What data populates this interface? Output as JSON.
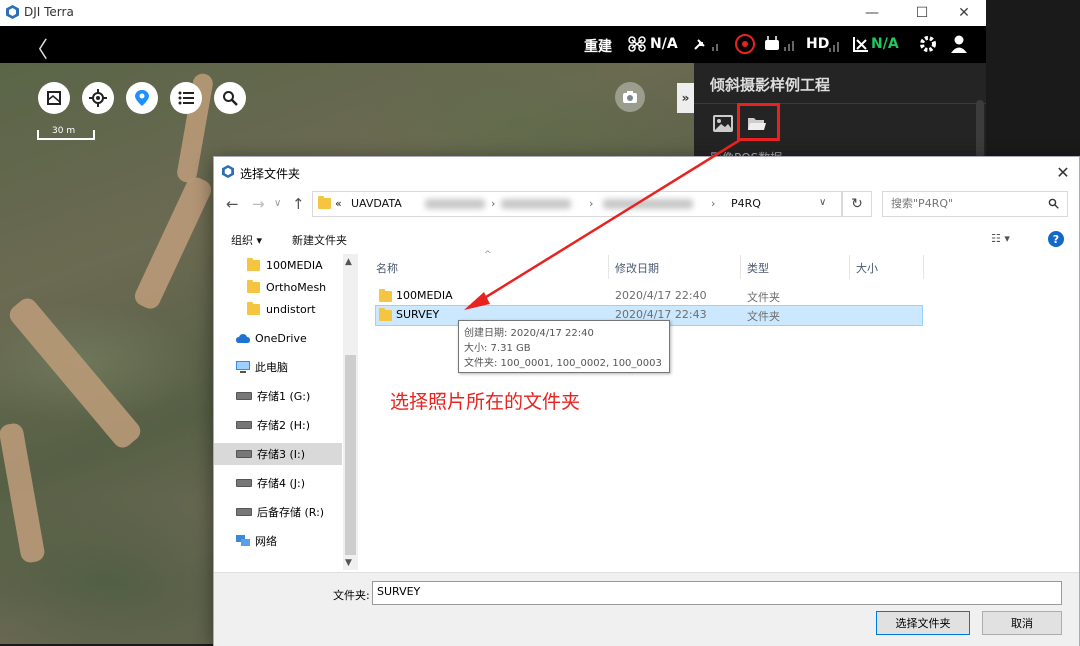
{
  "app": {
    "title": "DJI Terra",
    "min_label": "—",
    "max_label": "☐",
    "close_label": "✕"
  },
  "topbar": {
    "back_glyph": "〈",
    "rebuild": "重建",
    "drone_status": "N/A",
    "hd_label": "HD",
    "rc_status": "N/A",
    "status_green": "#22c55e"
  },
  "map": {
    "scale_label": "30 m"
  },
  "panel": {
    "project_title": "倾斜摄影样例工程",
    "collapse_label": "»",
    "partial_row": "影像POS数据"
  },
  "dialog": {
    "title": "选择文件夹",
    "address": {
      "prefix": "«",
      "part1": "UAVDATA",
      "sep": "›",
      "part_last": "P4RQ"
    },
    "search_placeholder": "搜索\"P4RQ\"",
    "organize": "组织 ▾",
    "new_folder": "新建文件夹",
    "nav": [
      {
        "label": "100MEDIA",
        "icon": "folder-icon"
      },
      {
        "label": "OrthoMesh",
        "icon": "folder-icon"
      },
      {
        "label": "undistort",
        "icon": "folder-icon"
      },
      {
        "label": "OneDrive",
        "icon": "cloud-icon"
      },
      {
        "label": "此电脑",
        "icon": "computer-icon"
      },
      {
        "label": "存储1 (G:)",
        "icon": "drive-icon"
      },
      {
        "label": "存储2 (H:)",
        "icon": "drive-icon"
      },
      {
        "label": "存储3 (I:)",
        "icon": "drive-icon"
      },
      {
        "label": "存储4 (J:)",
        "icon": "drive-icon"
      },
      {
        "label": "后备存储 (R:)",
        "icon": "drive-icon"
      },
      {
        "label": "网络",
        "icon": "network-icon"
      }
    ],
    "columns": {
      "name": "名称",
      "modified": "修改日期",
      "type": "类型",
      "size": "大小"
    },
    "files": [
      {
        "name": "100MEDIA",
        "modified": "2020/4/17 22:40",
        "type": "文件夹"
      },
      {
        "name": "SURVEY",
        "modified": "2020/4/17 22:43",
        "type": "文件夹"
      }
    ],
    "tooltip": {
      "created": "创建日期: 2020/4/17 22:40",
      "size": "大小: 7.31 GB",
      "folders": "文件夹: 100_0001, 100_0002, 100_0003"
    },
    "folder_label": "文件夹:",
    "folder_value": "SURVEY",
    "select_button": "选择文件夹",
    "cancel_button": "取消"
  },
  "annotation": {
    "text": "选择照片所在的文件夹",
    "color": "#e8231f"
  }
}
